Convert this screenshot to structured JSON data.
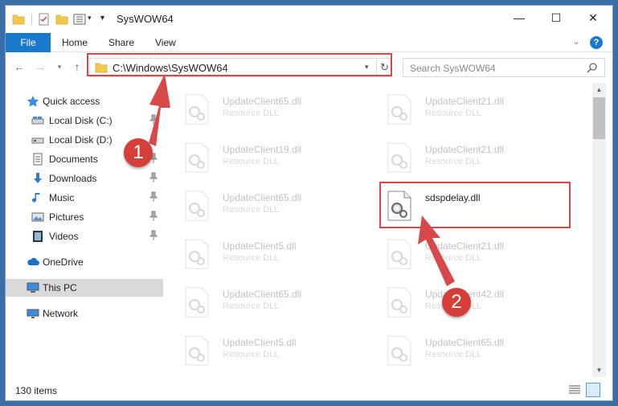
{
  "window": {
    "title": "SysWOW64",
    "controls": {
      "minimize": "—",
      "maximize": "☐",
      "close": "✕"
    }
  },
  "ribbon": {
    "tabs": [
      "File",
      "Home",
      "Share",
      "View"
    ],
    "help": "?"
  },
  "address": {
    "path": "C:\\Windows\\SysWOW64",
    "search_placeholder": "Search SysWOW64"
  },
  "nav": {
    "quick_access": "Quick access",
    "items": [
      {
        "label": "Local Disk (C:)",
        "icon": "drive-icon"
      },
      {
        "label": "Local Disk (D:)",
        "icon": "drive-icon"
      },
      {
        "label": "Documents",
        "icon": "documents-icon"
      },
      {
        "label": "Downloads",
        "icon": "downloads-icon"
      },
      {
        "label": "Music",
        "icon": "music-icon"
      },
      {
        "label": "Pictures",
        "icon": "pictures-icon"
      },
      {
        "label": "Videos",
        "icon": "videos-icon"
      }
    ],
    "onedrive": "OneDrive",
    "this_pc": "This PC",
    "network": "Network"
  },
  "files": {
    "left_column": [
      {
        "name": "UpdateClient65.dll",
        "type": "Resource DLL"
      },
      {
        "name": "UpdateClient19.dll",
        "type": "Resource DLL"
      },
      {
        "name": "UpdateClient65.dll",
        "type": "Resource DLL"
      },
      {
        "name": "UpdateClient5.dll",
        "type": "Resource DLL"
      },
      {
        "name": "UpdateClient65.dll",
        "type": "Resource DLL"
      },
      {
        "name": "UpdateClient5.dll",
        "type": "Resource DLL"
      }
    ],
    "right_column": [
      {
        "name": "UpdateClient21.dll",
        "type": "Resource DLL"
      },
      {
        "name": "UpdateClient21.dll",
        "type": "Resource DLL"
      },
      {
        "name": "sdspdelay.dll",
        "type": ""
      },
      {
        "name": "UpdateClient21.dll",
        "type": "Resource DLL"
      },
      {
        "name": "UpdateClient42.dll",
        "type": "Resource DLL"
      },
      {
        "name": "UpdateClient65.dll",
        "type": "Resource DLL"
      }
    ]
  },
  "status": {
    "item_count": "130 items"
  },
  "annotations": {
    "step1": "1",
    "step2": "2",
    "color": "#d94848"
  }
}
